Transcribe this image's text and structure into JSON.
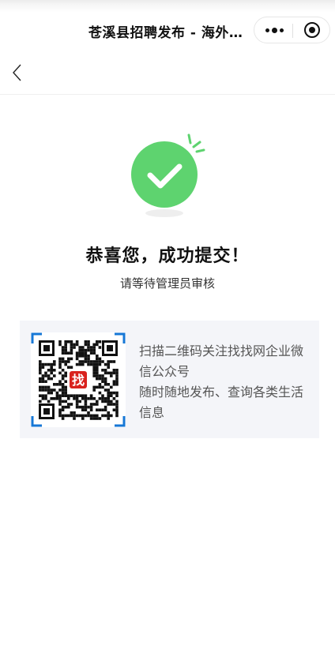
{
  "nav": {
    "title": "苍溪县招聘发布 - 海外和乐",
    "more_icon": "more-dots-icon",
    "close_icon": "target-icon",
    "back_icon": "chevron-left-icon"
  },
  "result": {
    "icon": "check-circle-icon",
    "heading": "恭喜您，成功提交！",
    "subtext": "请等待管理员审核",
    "accent_color": "#5ed36f"
  },
  "promo": {
    "qr_badge": "找",
    "line1": "扫描二维码关注找找网企业微信公众号",
    "line2": "随时随地发布、查询各类生活信息",
    "corner_color": "#1677d6",
    "badge_color": "#d9221e"
  }
}
